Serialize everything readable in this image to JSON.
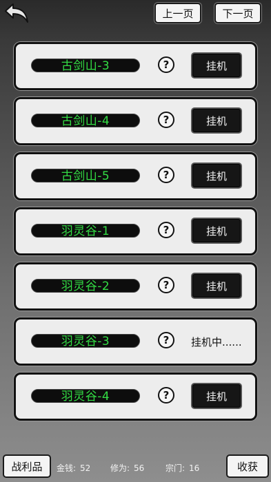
{
  "header": {
    "prev_label": "上一页",
    "next_label": "下一页"
  },
  "locations": [
    {
      "name": "古剑山-3",
      "action": "挂机",
      "active": false
    },
    {
      "name": "古剑山-4",
      "action": "挂机",
      "active": false
    },
    {
      "name": "古剑山-5",
      "action": "挂机",
      "active": false
    },
    {
      "name": "羽灵谷-1",
      "action": "挂机",
      "active": false
    },
    {
      "name": "羽灵谷-2",
      "action": "挂机",
      "active": false
    },
    {
      "name": "羽灵谷-3",
      "action": "挂机中......",
      "active": true
    },
    {
      "name": "羽灵谷-4",
      "action": "挂机",
      "active": false
    }
  ],
  "help_glyph": "?",
  "footer": {
    "spoils_label": "战利品",
    "money_label": "金钱:",
    "money_value": "52",
    "cultivation_label": "修为:",
    "cultivation_value": "56",
    "sect_label": "宗门:",
    "sect_value": "16",
    "harvest_label": "收获"
  },
  "icons": {
    "back": "back-arrow-icon",
    "help": "question-circle-icon"
  },
  "colors": {
    "name_text": "#33dd44",
    "name_bg": "#0d0d0d",
    "card_bg": "#ededed"
  }
}
